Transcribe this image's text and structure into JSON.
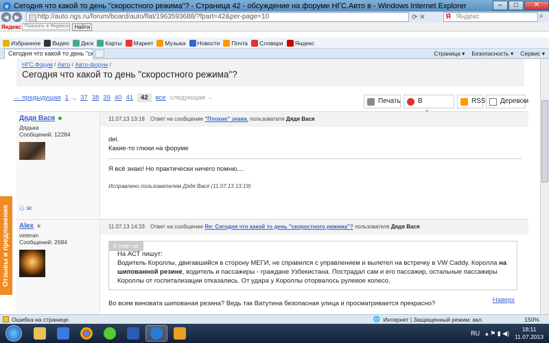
{
  "window": {
    "title": "Сегодня что какой то день \"скоростного режима\"? - Страница 42 - обсуждение на форуме НГС.Авто в - Windows Internet Explorer"
  },
  "address": {
    "url": "http://auto.ngs.ru/forum/board/auto/flat/1963593688/?fpart=42&per-page=10",
    "search_placeholder": "Яндекс"
  },
  "yandex_toolbar": {
    "brand": "Яндекс",
    "search_placeholder": "Поискать в Яндексе",
    "find_label": "Найти"
  },
  "bookmarks": [
    {
      "label": "Избранное",
      "icon": "favorites-icon",
      "color": "#e6b400"
    },
    {
      "label": "Видео",
      "icon": "video-icon",
      "color": "#333333"
    },
    {
      "label": "Диск",
      "icon": "disk-icon",
      "color": "#4a8"
    },
    {
      "label": "Карты",
      "icon": "maps-icon",
      "color": "#4a8"
    },
    {
      "label": "Маркет",
      "icon": "market-icon",
      "color": "#e33"
    },
    {
      "label": "Музыка",
      "icon": "music-icon",
      "color": "#f90"
    },
    {
      "label": "Новости",
      "icon": "news-icon",
      "color": "#36c"
    },
    {
      "label": "Почта",
      "icon": "mail-icon",
      "color": "#f90"
    },
    {
      "label": "Словари",
      "icon": "dictionary-icon",
      "color": "#d33"
    },
    {
      "label": "Яндекс",
      "icon": "yandex-icon",
      "color": "#c00"
    }
  ],
  "tab": {
    "label": "Сегодня что какой то день \"ск...\""
  },
  "tab_tools": [
    "Страница ▾",
    "Безопасность ▾",
    "Сервис ▾"
  ],
  "sidebar_tab": "Отзывы и предложения",
  "breadcrumbs": [
    "НГС.Форум",
    "Авто",
    "Авто-форум"
  ],
  "topic_title": "Сегодня что какой то день \"скоростного режима\"?",
  "pager": {
    "prev": "← предыдущая",
    "pages": [
      "1",
      "..",
      "37",
      "38",
      "39",
      "40",
      "41"
    ],
    "current": "42",
    "all": "все",
    "next": "следующая →"
  },
  "actions": {
    "print": "Печать",
    "favorite": "В избранное",
    "rss": "RSS",
    "tree": "Деревом"
  },
  "posts": [
    {
      "author": "Дядя Вася",
      "status_color": "#3a3",
      "rank": "Дядька",
      "messages": "Сообщений: 12284",
      "date": "11.07.13 13:18",
      "reply_prefix": "Ответ на сообщение",
      "reply_title": "\"Плохие\" знаки.",
      "reply_user_prefix": "пользователя",
      "reply_user": "Дядя Вася",
      "body_line1": "del.",
      "body_line2": "Какие-то глюки на форуме",
      "signature": "Я всё знаю! Но практически ничего помню....",
      "edited": "Исправлено пользователем Дядя Вася (11.07.13 13:19)"
    },
    {
      "author": "Alex",
      "status_color": "#aaa",
      "rank": "veteran",
      "messages": "Сообщений: 2684",
      "date": "11.07.13 14:33",
      "reply_prefix": "Ответ на сообщение",
      "reply_title": "Re: Сегодня что какой то день \"скоростного режима\"?",
      "reply_user_prefix": "пользователя",
      "reply_user": "Дядя Вася",
      "quote_label": "В ответ на:",
      "quote_author_line": "На АСТ пишут:",
      "quote_part1": "Водитель Короллы, двигавшийся в сторону МЕГИ, не справился с управлением и вылетел на встречку в VW Caddy. Королла",
      "quote_bold1": "на шипованной резине",
      "quote_part2": ", водитель и пассажиры - граждане Узбекистана. Пострадал сам и его пассажир, остальные пассажиры Короллы от госпитализации отказались. От удара у Короллы оторвалось рулевое колесо.",
      "reply_text": "Во всем виновата шипованая резина? Ведь так Ватутина безопасная улица и просматривается прекрасно?",
      "back_link": "Наверх"
    }
  ],
  "statusbar": {
    "message": "Ошибка на странице.",
    "zone": "Интернет | Защищенный режим: вкл.",
    "zoom": "150%"
  },
  "taskbar": {
    "lang": "RU",
    "time": "18:11",
    "date": "11.07.2013"
  }
}
